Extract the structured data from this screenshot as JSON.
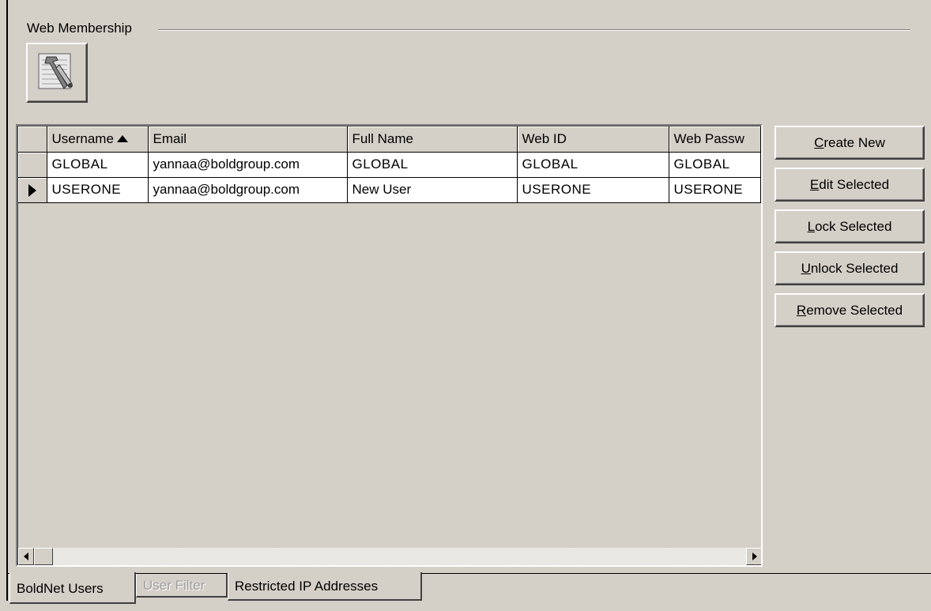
{
  "group": {
    "title": "Web Membership",
    "tool_icon": "tools-icon"
  },
  "grid": {
    "columns": [
      {
        "label": "Username",
        "sorted": "ascending"
      },
      {
        "label": "Email"
      },
      {
        "label": "Full Name"
      },
      {
        "label": "Web ID"
      },
      {
        "label": "Web Passw"
      }
    ],
    "rows": [
      {
        "username": "GLOBAL",
        "email": "yannaa@boldgroup.com",
        "full_name": "GLOBAL",
        "web_id": "GLOBAL",
        "web_password": "GLOBAL",
        "current": false
      },
      {
        "username": "USERONE",
        "email": "yannaa@boldgroup.com",
        "full_name": "New User",
        "web_id": "USERONE",
        "web_password": "USERONE",
        "current": true
      }
    ]
  },
  "actions": {
    "create": {
      "accel": "C",
      "rest": "reate New"
    },
    "edit": {
      "accel": "E",
      "rest": "dit Selected"
    },
    "lock": {
      "accel": "L",
      "rest": "ock Selected"
    },
    "unlock": {
      "accel": "U",
      "rest": "nlock Selected"
    },
    "remove": {
      "accel": "R",
      "rest": "emove Selected"
    }
  },
  "tabs": [
    {
      "label": "BoldNet Users",
      "state": "active"
    },
    {
      "label": "User Filter",
      "state": "disabled"
    },
    {
      "label": "Restricted IP Addresses",
      "state": "normal"
    }
  ]
}
